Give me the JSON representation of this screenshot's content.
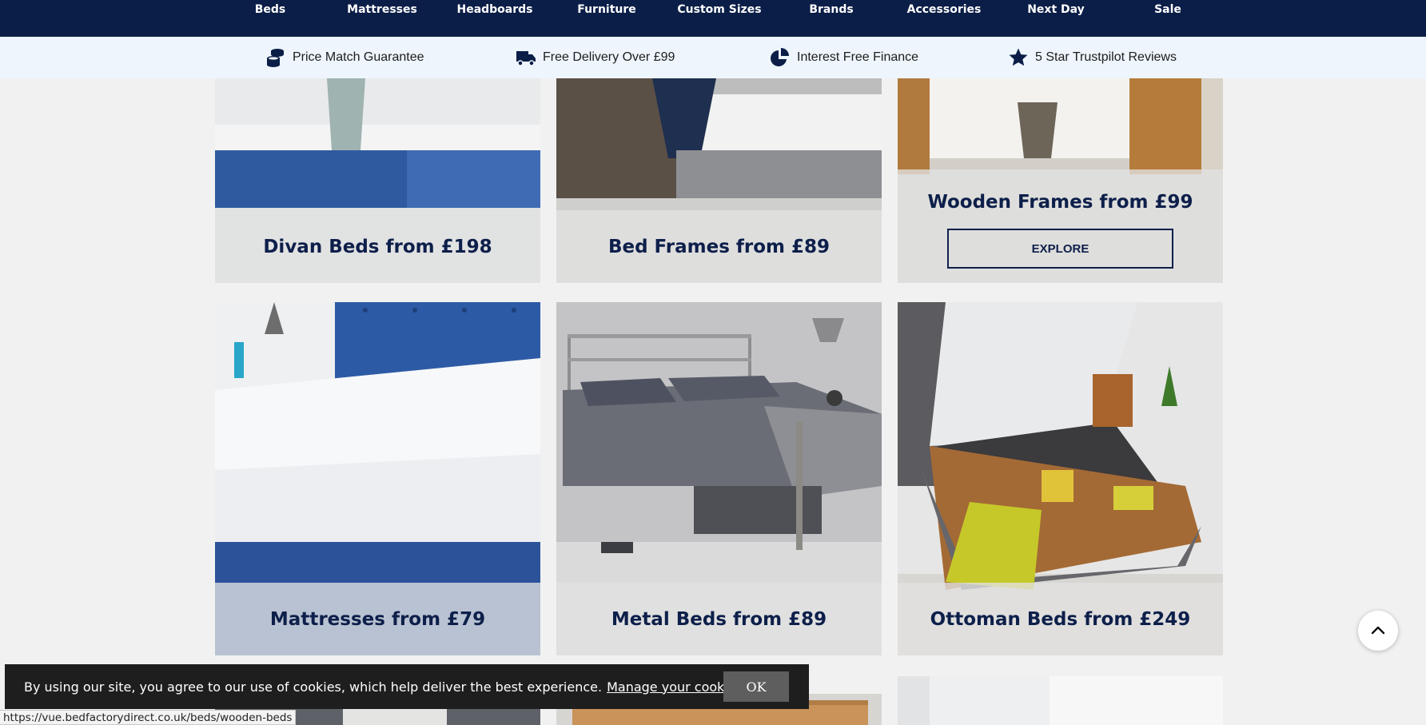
{
  "nav": {
    "items": [
      "Beds",
      "Mattresses",
      "Headboards",
      "Furniture",
      "Custom Sizes",
      "Brands",
      "Accessories",
      "Next Day",
      "Sale"
    ]
  },
  "usps": [
    {
      "icon": "coins-icon",
      "label": "Price Match Guarantee"
    },
    {
      "icon": "delivery-truck-icon",
      "label": "Free Delivery Over £99"
    },
    {
      "icon": "pie-chart-icon",
      "label": "Interest Free Finance"
    },
    {
      "icon": "star-icon",
      "label": "5 Star Trustpilot Reviews"
    }
  ],
  "cards": [
    {
      "title": "Divan Beds from £198"
    },
    {
      "title": "Bed Frames from £89"
    },
    {
      "title": "Wooden Frames from £99",
      "button": "EXPLORE"
    },
    {
      "title": "Mattresses from £79"
    },
    {
      "title": "Metal Beds from £89"
    },
    {
      "title": "Ottoman Beds from £249"
    }
  ],
  "cookie": {
    "text": "By using our site, you agree to our use of cookies, which help deliver the best experience.",
    "link": "Manage your cookies here",
    "ok": "OK"
  },
  "status": {
    "url": "https://vue.bedfactorydirect.co.uk/beds/wooden-beds"
  },
  "colors": {
    "navy": "#0b1e47",
    "usp_bg": "#eef5fc",
    "page_bg": "#f1f1f1"
  }
}
